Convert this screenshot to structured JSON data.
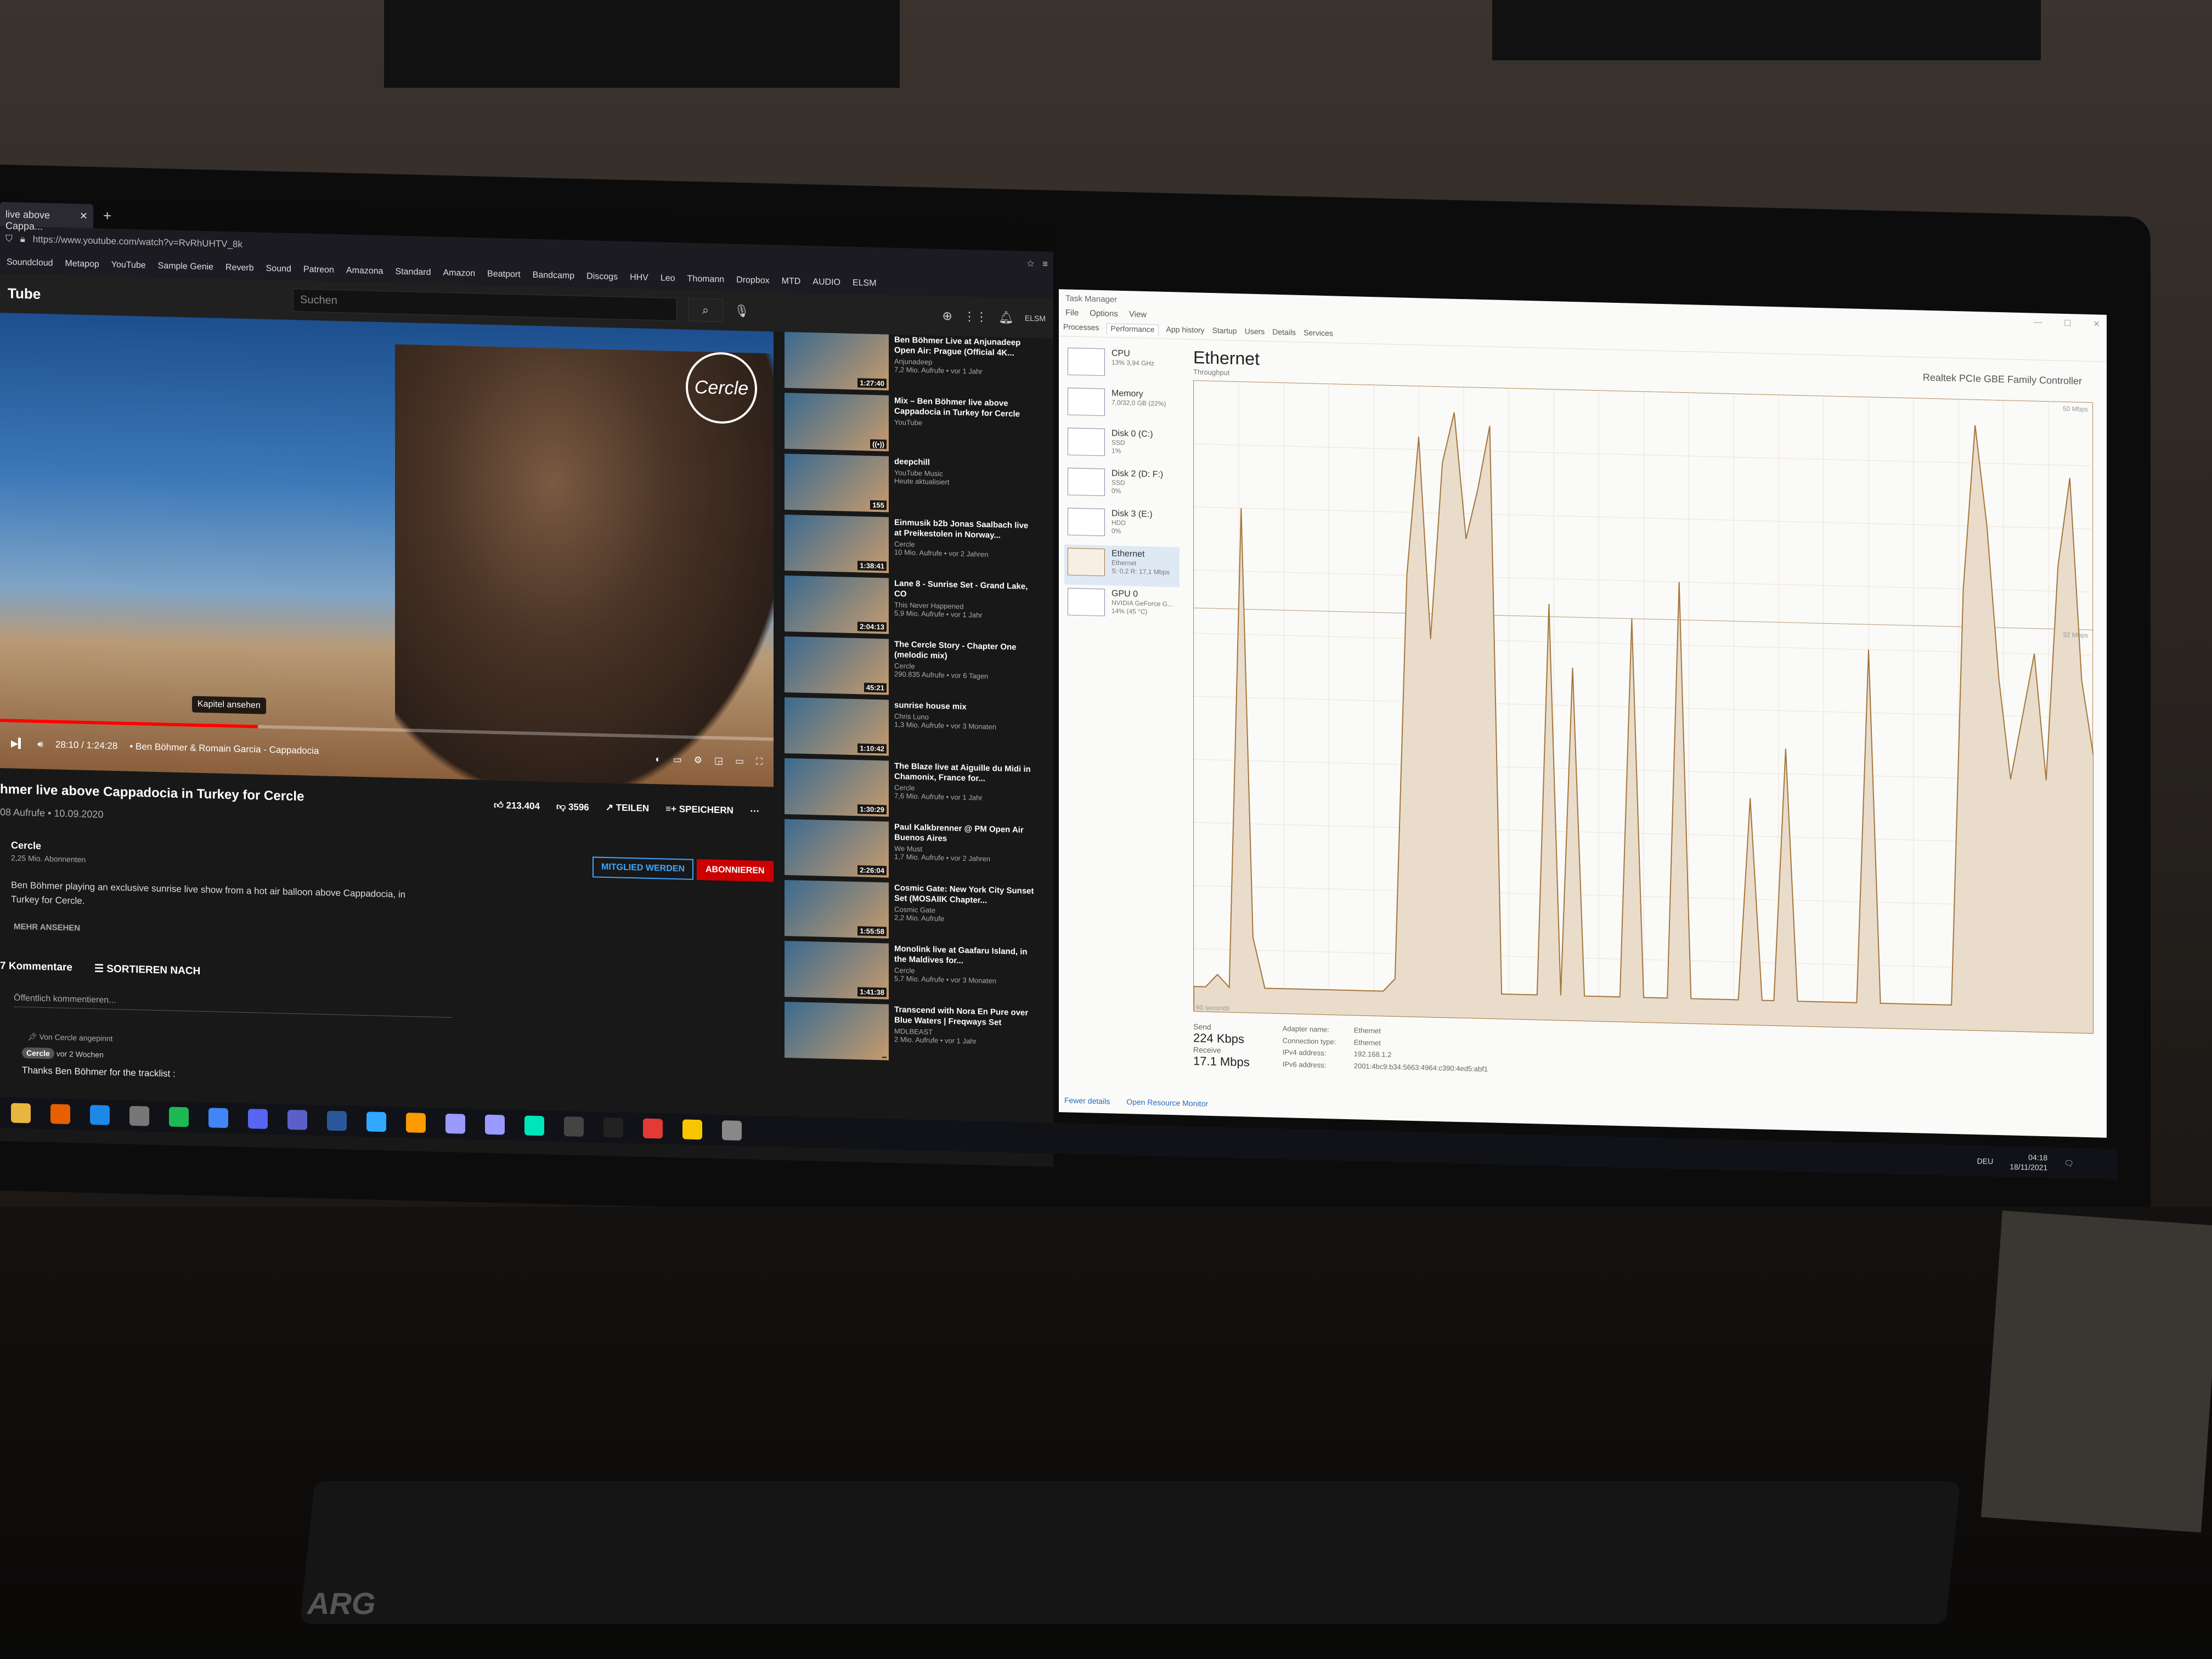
{
  "browser": {
    "tab_title": "live above Cappa...",
    "url": "https://www.youtube.com/watch?v=RvRhUHTV_8k",
    "bookmarks": [
      "Soundcloud",
      "Metapop",
      "YouTube",
      "Sample Genie",
      "Reverb",
      "Sound",
      "Patreon",
      "Amazona",
      "Standard",
      "Amazon",
      "Beatport",
      "Bandcamp",
      "Discogs",
      "HHV",
      "Leo",
      "Thomann",
      "Dropbox",
      "MTD",
      "AUDIO",
      "ELSM"
    ]
  },
  "youtube": {
    "logo": "Tube",
    "search_placeholder": "Suchen",
    "player": {
      "channel_logo": "Cercle",
      "chapter_tooltip": "Kapitel ansehen",
      "time": "28:10 / 1:24:28",
      "chapter_title": "• Ben Böhmer & Romain Garcia - Cappadocia",
      "progress_fraction": 0.333
    },
    "title": "hmer live above Cappadocia in Turkey for Cercle",
    "meta": "08 Aufrufe • 10.09.2020",
    "likes": "213.404",
    "dislikes": "3596",
    "share": "TEILEN",
    "save": "SPEICHERN",
    "channel": {
      "name": "Cercle",
      "subs": "2,25 Mio. Abonnenten"
    },
    "member_button": "MITGLIED WERDEN",
    "subscribe_button": "ABONNIEREN",
    "description": "Ben Böhmer playing an exclusive sunrise live show from a hot air balloon above Cappadocia, in Turkey for Cercle.",
    "more": "MEHR ANSEHEN",
    "comments_count": "7 Kommentare",
    "sort": "SORTIEREN NACH",
    "comment_placeholder": "Öffentlich kommentieren...",
    "pinned": "Von Cercle angepinnt",
    "comment_author": "Cercle",
    "comment_age": "vor 2 Wochen",
    "comment_text": "Thanks Ben Böhmer for the tracklist :",
    "recommendations": [
      {
        "title": "Ben Böhmer Live at Anjunadeep Open Air: Prague (Official 4K...",
        "channel": "Anjunadeep",
        "meta": "7,2 Mio. Aufrufe • vor 1 Jahr",
        "duration": "1:27:40"
      },
      {
        "title": "Mix – Ben Böhmer live above Cappadocia in Turkey for Cercle",
        "channel": "YouTube",
        "meta": "",
        "duration": "((•))"
      },
      {
        "title": "deepchill",
        "channel": "YouTube Music",
        "meta": "Heute aktualisiert",
        "duration": "155"
      },
      {
        "title": "Einmusik b2b Jonas Saalbach live at Preikestolen in Norway...",
        "channel": "Cercle",
        "meta": "10 Mio. Aufrufe • vor 2 Jahren",
        "duration": "1:38:41"
      },
      {
        "title": "Lane 8 - Sunrise Set - Grand Lake, CO",
        "channel": "This Never Happened",
        "meta": "5,9 Mio. Aufrufe • vor 1 Jahr",
        "duration": "2:04:13"
      },
      {
        "title": "The Cercle Story - Chapter One (melodic mix)",
        "channel": "Cercle",
        "meta": "290.835 Aufrufe • vor 6 Tagen",
        "duration": "45:21"
      },
      {
        "title": "sunrise house mix",
        "channel": "Chris Luno",
        "meta": "1,3 Mio. Aufrufe • vor 3 Monaten",
        "duration": "1:10:42"
      },
      {
        "title": "The Blaze live at Aiguille du Midi in Chamonix, France for...",
        "channel": "Cercle",
        "meta": "7,6 Mio. Aufrufe • vor 1 Jahr",
        "duration": "1:30:29"
      },
      {
        "title": "Paul Kalkbrenner @ PM Open Air Buenos Aires",
        "channel": "We Must",
        "meta": "1,7 Mio. Aufrufe • vor 2 Jahren",
        "duration": "2:26:04"
      },
      {
        "title": "Cosmic Gate: New York City Sunset Set (MOSAIIK Chapter...",
        "channel": "Cosmic Gate",
        "meta": "2,2 Mio. Aufrufe",
        "duration": "1:55:58"
      },
      {
        "title": "Monolink live at Gaafaru Island, in the Maldives for...",
        "channel": "Cercle",
        "meta": "5,7 Mio. Aufrufe • vor 3 Monaten",
        "duration": "1:41:38"
      },
      {
        "title": "Transcend with Nora En Pure over Blue Waters | Freqways Set",
        "channel": "MDLBEAST",
        "meta": "2 Mio. Aufrufe • vor 1 Jahr",
        "duration": ""
      }
    ]
  },
  "task_manager": {
    "window_title": "Task Manager",
    "menu": [
      "File",
      "Options",
      "View"
    ],
    "tabs": [
      "Processes",
      "Performance",
      "App history",
      "Startup",
      "Users",
      "Details",
      "Services"
    ],
    "resources": [
      {
        "name": "CPU",
        "detail": "13% 3,94 GHz"
      },
      {
        "name": "Memory",
        "detail": "7,0/32,0 GB (22%)"
      },
      {
        "name": "Disk 0 (C:)",
        "detail": "SSD\n1%"
      },
      {
        "name": "Disk 2 (D: F:)",
        "detail": "SSD\n0%"
      },
      {
        "name": "Disk 3 (E:)",
        "detail": "HDD\n0%"
      },
      {
        "name": "Ethernet",
        "detail": "Ethernet\nS: 0,2 R: 17,1 Mbps"
      },
      {
        "name": "GPU 0",
        "detail": "NVIDIA GeForce G...\n14% (45 °C)"
      }
    ],
    "heading": "Ethernet",
    "adapter": "Realtek PCIe GBE Family Controller",
    "throughput_label": "Throughput",
    "scale_max": "50 Mbps",
    "scale_mid": "32 Mbps",
    "time_label": "60 seconds",
    "send_label": "Send",
    "send_value": "224 Kbps",
    "receive_label": "Receive",
    "receive_value": "17.1 Mbps",
    "details": [
      {
        "k": "Adapter name:",
        "v": "Ethernet"
      },
      {
        "k": "Connection type:",
        "v": "Ethernet"
      },
      {
        "k": "IPv4 address:",
        "v": "192.168.1.2"
      },
      {
        "k": "IPv6 address:",
        "v": "2001:4bc9:b34:5663:4964:c390:4ed5:abf1"
      }
    ],
    "fewer_details": "Fewer details",
    "resource_monitor": "Open Resource Monitor",
    "throughput_series_mbps": [
      2,
      2,
      3,
      2,
      40,
      6,
      2,
      2,
      2,
      2,
      2,
      2,
      2,
      2,
      2,
      2,
      2,
      3,
      35,
      46,
      30,
      44,
      48,
      38,
      42,
      47,
      2,
      2,
      2,
      2,
      33,
      2,
      28,
      2,
      2,
      2,
      2,
      32,
      2,
      2,
      2,
      35,
      2,
      2,
      2,
      2,
      2,
      18,
      2,
      2,
      22,
      2,
      2,
      2,
      2,
      2,
      2,
      30,
      2,
      2,
      2,
      2,
      2,
      2,
      2,
      35,
      48,
      40,
      28,
      20,
      25,
      30,
      20,
      37,
      44,
      28,
      22
    ]
  },
  "taskbar": {
    "apps": [
      "File Explorer",
      "Firefox",
      "Edge",
      "Settings",
      "Spotify",
      "Chrome",
      "Discord",
      "Teams",
      "Word",
      "Ps",
      "Ai",
      "Pr",
      "Ae",
      "Au",
      "M",
      "Volt",
      "Notes",
      "Sticky",
      "Folder"
    ],
    "lang": "DEU",
    "time": "04:18",
    "date": "18/11/2021"
  },
  "colors": {
    "youtube_red": "#cc0000",
    "ethernet_line": "#a5763b",
    "ethernet_fill": "#e9dccb",
    "link_blue": "#3ea6ff"
  },
  "keyboard_brand": "ARG"
}
